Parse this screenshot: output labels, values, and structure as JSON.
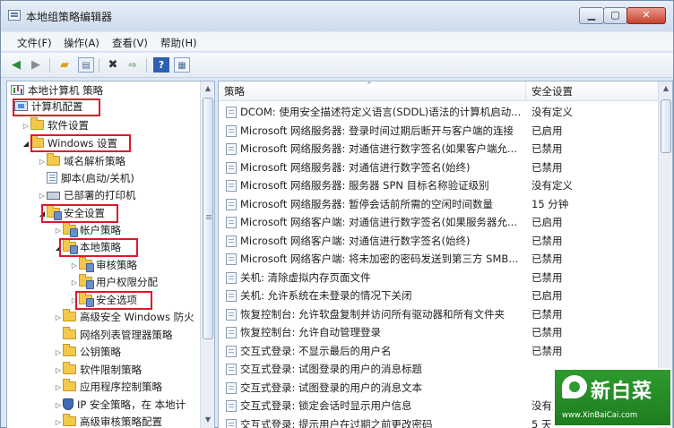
{
  "window": {
    "title": "本地组策略编辑器"
  },
  "menu": [
    "文件(F)",
    "操作(A)",
    "查看(V)",
    "帮助(H)"
  ],
  "toolbar": {
    "icons": [
      "back-arrow",
      "forward-arrow",
      "folder-up",
      "show-hide-tree",
      "delete",
      "export-list",
      "help",
      "properties"
    ]
  },
  "tree": {
    "root": "本地计算机 策略",
    "nodes": [
      {
        "label": "计算机配置",
        "icon": "computer",
        "toggle": "",
        "highlight": true
      },
      {
        "label": "软件设置",
        "icon": "folder",
        "toggle": "▷"
      },
      {
        "label": "Windows 设置",
        "icon": "folder",
        "toggle": "◢",
        "highlight": true
      },
      {
        "label": "域名解析策略",
        "icon": "folder",
        "toggle": "▷"
      },
      {
        "label": "脚本(启动/关机)",
        "icon": "script",
        "toggle": ""
      },
      {
        "label": "已部署的打印机",
        "icon": "printer",
        "toggle": "▷"
      },
      {
        "label": "安全设置",
        "icon": "secfolder",
        "toggle": "◢",
        "highlight": true
      },
      {
        "label": "帐户策略",
        "icon": "secfolder",
        "toggle": "▷"
      },
      {
        "label": "本地策略",
        "icon": "secfolder",
        "toggle": "◢",
        "highlight": true
      },
      {
        "label": "审核策略",
        "icon": "secfolder",
        "toggle": "▷"
      },
      {
        "label": "用户权限分配",
        "icon": "secfolder",
        "toggle": "▷"
      },
      {
        "label": "安全选项",
        "icon": "secfolder",
        "toggle": "▷",
        "highlight": true
      },
      {
        "label": "高级安全 Windows 防火",
        "icon": "folder",
        "toggle": "▷"
      },
      {
        "label": "网络列表管理器策略",
        "icon": "folder",
        "toggle": ""
      },
      {
        "label": "公钥策略",
        "icon": "folder",
        "toggle": "▷"
      },
      {
        "label": "软件限制策略",
        "icon": "folder",
        "toggle": "▷"
      },
      {
        "label": "应用程序控制策略",
        "icon": "folder",
        "toggle": "▷"
      },
      {
        "label": "IP 安全策略，在 本地计",
        "icon": "shield",
        "toggle": "▷"
      },
      {
        "label": "高级审核策略配置",
        "icon": "folder",
        "toggle": "▷"
      }
    ]
  },
  "list": {
    "col_name": "策略",
    "col_setting": "安全设置",
    "rows": [
      {
        "name": "DCOM: 使用安全描述符定义语言(SDDL)语法的计算机启动...",
        "setting": "没有定义"
      },
      {
        "name": "Microsoft 网络服务器: 登录时间过期后断开与客户端的连接",
        "setting": "已启用"
      },
      {
        "name": "Microsoft 网络服务器: 对通信进行数字签名(如果客户端允...",
        "setting": "已禁用"
      },
      {
        "name": "Microsoft 网络服务器: 对通信进行数字签名(始终)",
        "setting": "已禁用"
      },
      {
        "name": "Microsoft 网络服务器: 服务器 SPN 目标名称验证级别",
        "setting": "没有定义"
      },
      {
        "name": "Microsoft 网络服务器: 暂停会话前所需的空闲时间数量",
        "setting": "15 分钟"
      },
      {
        "name": "Microsoft 网络客户端: 对通信进行数字签名(如果服务器允...",
        "setting": "已启用"
      },
      {
        "name": "Microsoft 网络客户端: 对通信进行数字签名(始终)",
        "setting": "已禁用"
      },
      {
        "name": "Microsoft 网络客户端: 将未加密的密码发送到第三方 SMB...",
        "setting": "已禁用"
      },
      {
        "name": "关机: 清除虚拟内存页面文件",
        "setting": "已禁用"
      },
      {
        "name": "关机: 允许系统在未登录的情况下关闭",
        "setting": "已启用"
      },
      {
        "name": "恢复控制台: 允许软盘复制并访问所有驱动器和所有文件夹",
        "setting": "已禁用"
      },
      {
        "name": "恢复控制台: 允许自动管理登录",
        "setting": "已禁用"
      },
      {
        "name": "交互式登录: 不显示最后的用户名",
        "setting": "已禁用"
      },
      {
        "name": "交互式登录: 试图登录的用户的消息标题",
        "setting": ""
      },
      {
        "name": "交互式登录: 试图登录的用户的消息文本",
        "setting": ""
      },
      {
        "name": "交互式登录: 锁定会话时显示用户信息",
        "setting": "没有定义"
      },
      {
        "name": "交互式登录: 提示用户在过期之前更改密码",
        "setting": "5 天"
      }
    ]
  },
  "watermark": {
    "text": "新白菜",
    "url": "www.XinBaiCai.com"
  }
}
